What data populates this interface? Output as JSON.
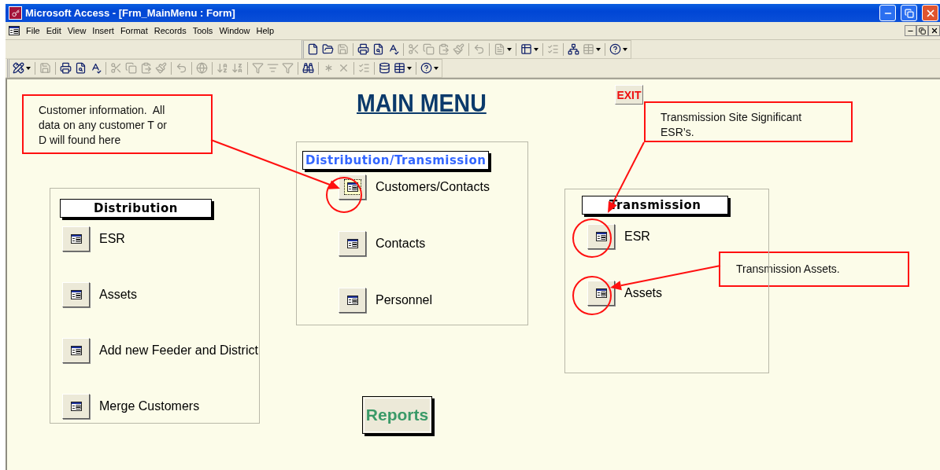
{
  "window": {
    "title": "Microsoft Access - [Frm_MainMenu : Form]"
  },
  "menu": [
    "File",
    "Edit",
    "View",
    "Insert",
    "Format",
    "Records",
    "Tools",
    "Window",
    "Help"
  ],
  "toolbars": [
    {
      "items": [
        {
          "kind": "new",
          "disabled": false
        },
        {
          "kind": "open",
          "disabled": false
        },
        {
          "kind": "save",
          "disabled": true
        },
        {
          "kind": "separator"
        },
        {
          "kind": "print",
          "disabled": false
        },
        {
          "kind": "preview",
          "disabled": false
        },
        {
          "kind": "spelling",
          "disabled": false
        },
        {
          "kind": "separator"
        },
        {
          "kind": "cut",
          "disabled": true
        },
        {
          "kind": "copy",
          "disabled": true
        },
        {
          "kind": "paste",
          "disabled": true
        },
        {
          "kind": "painter",
          "disabled": true
        },
        {
          "kind": "separator"
        },
        {
          "kind": "undo",
          "disabled": true
        },
        {
          "kind": "separator"
        },
        {
          "kind": "officelinks",
          "disabled": true,
          "dropdown": true
        },
        {
          "kind": "separator"
        },
        {
          "kind": "analyze",
          "disabled": false,
          "dropdown": true
        },
        {
          "kind": "separator"
        },
        {
          "kind": "properties",
          "disabled": true
        },
        {
          "kind": "separator"
        },
        {
          "kind": "relationships",
          "disabled": false
        },
        {
          "kind": "newobject",
          "disabled": true,
          "dropdown": true
        },
        {
          "kind": "separator"
        },
        {
          "kind": "help",
          "disabled": false,
          "dropdown": true
        }
      ]
    },
    {
      "items": [
        {
          "kind": "view",
          "disabled": false,
          "dropdown": true
        },
        {
          "kind": "separator"
        },
        {
          "kind": "save",
          "disabled": true
        },
        {
          "kind": "separator"
        },
        {
          "kind": "print",
          "disabled": false
        },
        {
          "kind": "preview",
          "disabled": false
        },
        {
          "kind": "spelling",
          "disabled": false
        },
        {
          "kind": "separator"
        },
        {
          "kind": "cut",
          "disabled": true
        },
        {
          "kind": "copy",
          "disabled": true
        },
        {
          "kind": "paste",
          "disabled": true
        },
        {
          "kind": "painter",
          "disabled": true
        },
        {
          "kind": "separator"
        },
        {
          "kind": "undo",
          "disabled": true
        },
        {
          "kind": "separator"
        },
        {
          "kind": "hyperlink",
          "disabled": true
        },
        {
          "kind": "separator"
        },
        {
          "kind": "sortasc",
          "disabled": true
        },
        {
          "kind": "sortdesc",
          "disabled": true
        },
        {
          "kind": "separator"
        },
        {
          "kind": "filterselection",
          "disabled": true
        },
        {
          "kind": "filterform",
          "disabled": true
        },
        {
          "kind": "applyfilter",
          "disabled": true
        },
        {
          "kind": "separator"
        },
        {
          "kind": "find",
          "disabled": false
        },
        {
          "kind": "separator"
        },
        {
          "kind": "newrecord",
          "disabled": true
        },
        {
          "kind": "deleterecord",
          "disabled": true
        },
        {
          "kind": "separator"
        },
        {
          "kind": "properties",
          "disabled": true
        },
        {
          "kind": "separator"
        },
        {
          "kind": "dbwindow",
          "disabled": false
        },
        {
          "kind": "newobject",
          "disabled": false,
          "dropdown": true
        },
        {
          "kind": "separator"
        },
        {
          "kind": "help",
          "disabled": false,
          "dropdown": true
        }
      ]
    }
  ],
  "form": {
    "title": "MAIN MENU",
    "exit_button": "EXIT",
    "panels": [
      {
        "heading": "Distribution/Transmission",
        "color": "#3366ff",
        "items": [
          {
            "label": "Customers/Contacts",
            "focused": true
          },
          {
            "label": "Contacts",
            "focused": false
          },
          {
            "label": "Personnel",
            "focused": false
          }
        ]
      },
      {
        "heading": "Distribution",
        "color": "#000000",
        "items": [
          {
            "label": "ESR",
            "focused": false
          },
          {
            "label": "Assets",
            "focused": false
          },
          {
            "label": "Add new Feeder and District",
            "focused": false
          },
          {
            "label": "Merge Customers",
            "focused": false
          }
        ]
      },
      {
        "heading": "Transmission",
        "color": "#000000",
        "items": [
          {
            "label": "ESR",
            "focused": false
          },
          {
            "label": "Assets",
            "focused": false
          }
        ]
      }
    ],
    "reports_button": "Reports",
    "callouts": [
      {
        "text": "Customer information.  All data on any customer T or D will found here"
      },
      {
        "text": "Transmission Site Significant ESR’s."
      },
      {
        "text": "Transmission Assets."
      }
    ]
  }
}
